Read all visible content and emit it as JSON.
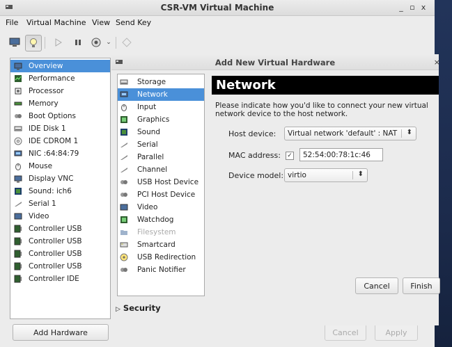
{
  "window": {
    "title": "CSR-VM Virtual Machine",
    "controls": {
      "minimize": "_",
      "maximize": "▫",
      "close": "x"
    }
  },
  "menubar": [
    "File",
    "Virtual Machine",
    "View",
    "Send Key"
  ],
  "toolbar": {
    "buttons": [
      "console-icon",
      "lightbulb-icon",
      "play-icon",
      "pause-icon",
      "power-icon",
      "chevron-down-icon",
      "fullscreen-icon"
    ],
    "selected": "lightbulb-icon"
  },
  "sidebar": {
    "items": [
      {
        "label": "Overview",
        "icon": "overview-icon"
      },
      {
        "label": "Performance",
        "icon": "performance-icon"
      },
      {
        "label": "Processor",
        "icon": "processor-icon"
      },
      {
        "label": "Memory",
        "icon": "memory-icon"
      },
      {
        "label": "Boot Options",
        "icon": "boot-options-icon"
      },
      {
        "label": "IDE Disk 1",
        "icon": "disk-icon"
      },
      {
        "label": "IDE CDROM 1",
        "icon": "cdrom-icon"
      },
      {
        "label": "NIC :64:84:79",
        "icon": "nic-icon"
      },
      {
        "label": "Mouse",
        "icon": "mouse-icon"
      },
      {
        "label": "Display VNC",
        "icon": "display-icon"
      },
      {
        "label": "Sound: ich6",
        "icon": "sound-icon"
      },
      {
        "label": "Serial 1",
        "icon": "serial-icon"
      },
      {
        "label": "Video",
        "icon": "video-icon"
      },
      {
        "label": "Controller USB",
        "icon": "controller-icon"
      },
      {
        "label": "Controller USB",
        "icon": "controller-icon"
      },
      {
        "label": "Controller USB",
        "icon": "controller-icon"
      },
      {
        "label": "Controller USB",
        "icon": "controller-icon"
      },
      {
        "label": "Controller IDE",
        "icon": "controller-icon"
      }
    ],
    "selected": "Overview",
    "add_button": "Add Hardware"
  },
  "bottom_buttons": {
    "cancel": "Cancel",
    "apply": "Apply"
  },
  "dialog": {
    "title": "Add New Virtual Hardware",
    "close": "×",
    "hardware_list": [
      {
        "label": "Storage",
        "icon": "storage-icon",
        "enabled": true
      },
      {
        "label": "Network",
        "icon": "network-icon",
        "enabled": true
      },
      {
        "label": "Input",
        "icon": "input-icon",
        "enabled": true
      },
      {
        "label": "Graphics",
        "icon": "graphics-icon",
        "enabled": true
      },
      {
        "label": "Sound",
        "icon": "sound-icon",
        "enabled": true
      },
      {
        "label": "Serial",
        "icon": "serial-icon",
        "enabled": true
      },
      {
        "label": "Parallel",
        "icon": "parallel-icon",
        "enabled": true
      },
      {
        "label": "Channel",
        "icon": "channel-icon",
        "enabled": true
      },
      {
        "label": "USB Host Device",
        "icon": "usb-icon",
        "enabled": true
      },
      {
        "label": "PCI Host Device",
        "icon": "pci-icon",
        "enabled": true
      },
      {
        "label": "Video",
        "icon": "video-icon",
        "enabled": true
      },
      {
        "label": "Watchdog",
        "icon": "watchdog-icon",
        "enabled": true
      },
      {
        "label": "Filesystem",
        "icon": "folder-icon",
        "enabled": false
      },
      {
        "label": "Smartcard",
        "icon": "smartcard-icon",
        "enabled": true
      },
      {
        "label": "USB Redirection",
        "icon": "usb-redirection-icon",
        "enabled": true
      },
      {
        "label": "Panic Notifier",
        "icon": "panic-notifier-icon",
        "enabled": true
      }
    ],
    "selected": "Network",
    "heading": "Network",
    "description": "Please indicate how you'd like to connect your new virtual network device to the host network.",
    "host_device_label": "Host device:",
    "host_device_value": "Virtual network 'default' : NAT",
    "mac_label": "MAC address:",
    "mac_checked": true,
    "mac_value": "52:54:00:78:1c:46",
    "model_label": "Device model:",
    "model_value": "virtio",
    "cancel": "Cancel",
    "finish": "Finish",
    "security": "Security"
  },
  "colors": {
    "selection": "#4a90d9",
    "banner_bg": "#000000",
    "window_bg": "#ececec"
  }
}
